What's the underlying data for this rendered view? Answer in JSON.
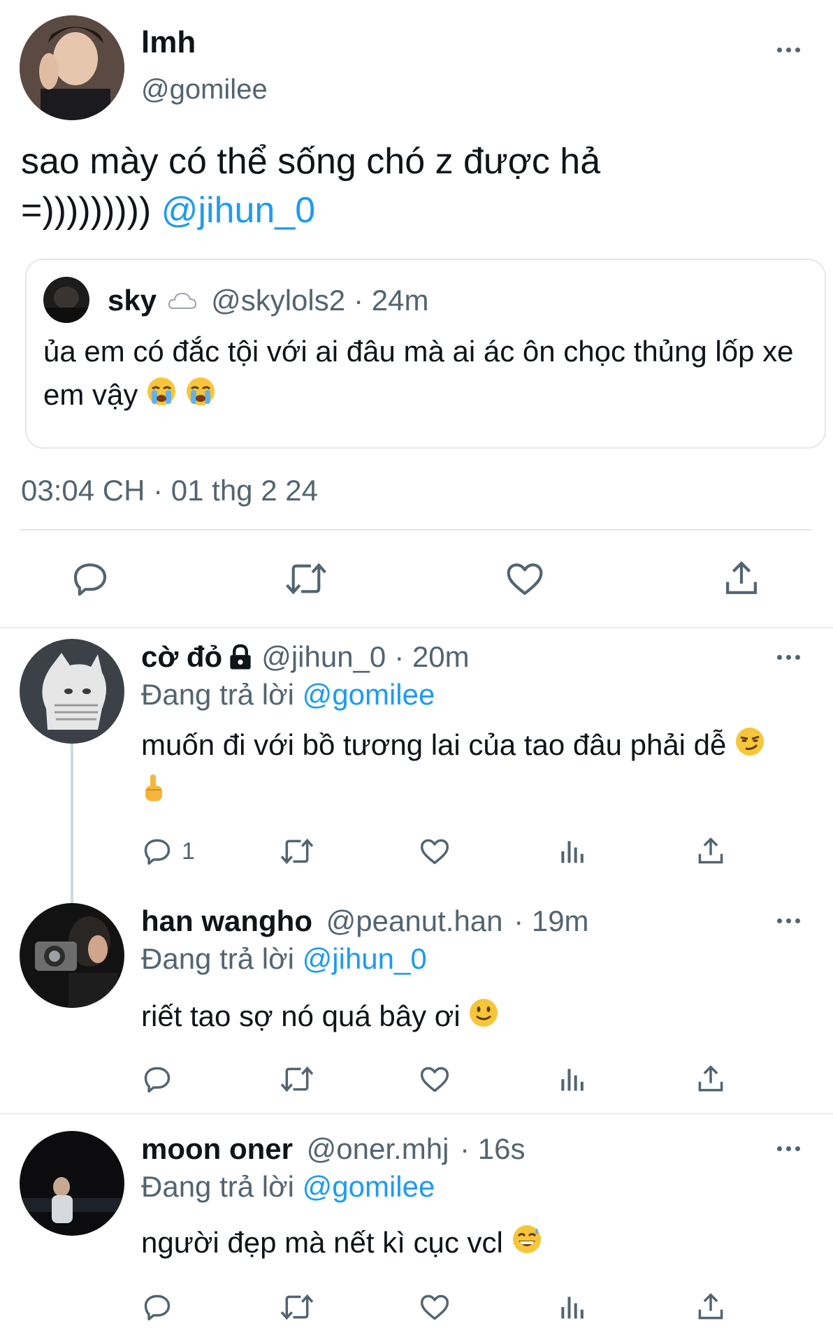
{
  "main_tweet": {
    "display_name": "lmh",
    "handle": "@gomilee",
    "text": "sao mày có thể sống chó z được hả =)))))))))",
    "mention": "@jihun_0",
    "quoted": {
      "display_name": "sky",
      "handle": "@skylols2",
      "time": "· 24m",
      "text": "ủa em có đắc tội với ai đâu mà ai ác ôn chọc thủng lốp xe em vậy"
    },
    "timestamp": "03:04 CH · 01 thg 2 24"
  },
  "replies": [
    {
      "display_name": "cờ đỏ",
      "handle": "@jihun_0",
      "time": "· 20m",
      "replying_label": "Đang trả lời",
      "replying_to": "@gomilee",
      "text": "muốn đi với bồ tương lai của tao đâu phải dễ",
      "reply_count": "1"
    },
    {
      "display_name": "han wangho",
      "handle": "@peanut.han",
      "time": "· 19m",
      "replying_label": "Đang trả lời",
      "replying_to": "@jihun_0",
      "text": "riết tao sợ nó quá bây ơi"
    },
    {
      "display_name": "moon oner",
      "handle": "@oner.mhj",
      "time": "· 16s",
      "replying_label": "Đang trả lời",
      "replying_to": "@gomilee",
      "text": "người đẹp mà nết kì cục vcl"
    }
  ],
  "icons": [
    "reply-icon",
    "retweet-icon",
    "like-icon",
    "views-icon",
    "share-icon",
    "more-icon",
    "lock-icon",
    "cloud-icon"
  ],
  "colors": {
    "accent": "#1d9bf0",
    "text": "#0f1419",
    "secondary": "#536471"
  }
}
